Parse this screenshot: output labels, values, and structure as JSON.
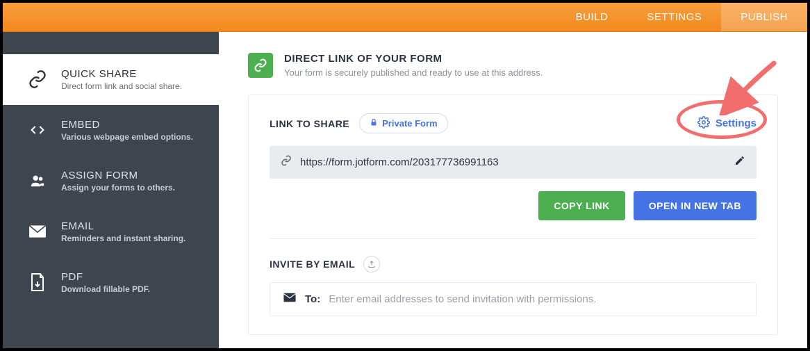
{
  "topbar": {
    "tabs": [
      {
        "label": "BUILD"
      },
      {
        "label": "SETTINGS"
      },
      {
        "label": "PUBLISH"
      }
    ]
  },
  "sidebar": {
    "items": [
      {
        "title": "QUICK SHARE",
        "sub": "Direct form link and social share."
      },
      {
        "title": "EMBED",
        "sub": "Various webpage embed options."
      },
      {
        "title": "ASSIGN FORM",
        "sub": "Assign your forms to others."
      },
      {
        "title": "EMAIL",
        "sub": "Reminders and instant sharing."
      },
      {
        "title": "PDF",
        "sub": "Download fillable PDF."
      }
    ]
  },
  "direct": {
    "title": "DIRECT LINK OF YOUR FORM",
    "subtitle": "Your form is securely published and ready to use at this address."
  },
  "share": {
    "label": "LINK TO SHARE",
    "private_badge": "Private Form",
    "settings_label": "Settings",
    "url": "https://form.jotform.com/203177736991163",
    "copy_btn": "COPY LINK",
    "open_btn": "OPEN IN NEW TAB"
  },
  "invite": {
    "label": "INVITE BY EMAIL",
    "to_label": "To:",
    "placeholder": "Enter email addresses to send invitation with permissions."
  }
}
